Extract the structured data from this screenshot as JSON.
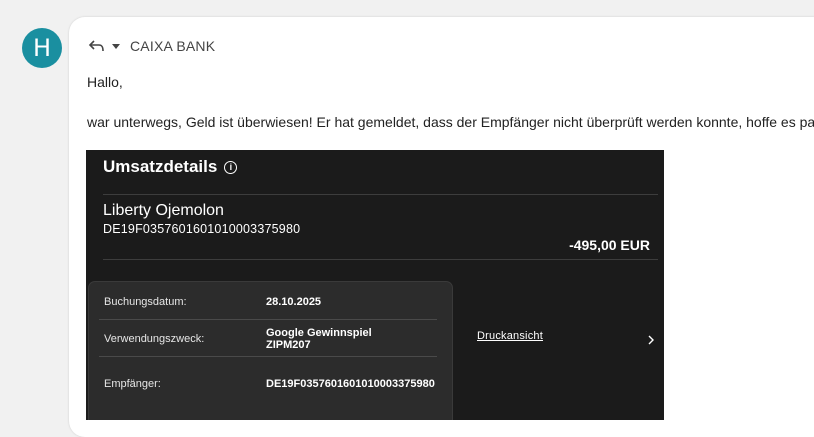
{
  "avatar": {
    "initial": "H",
    "color": "#1a8fa0"
  },
  "header": {
    "sender": "CAIXA BANK",
    "reply_icon": "reply-icon",
    "caret_icon": "chevron-down-icon"
  },
  "email": {
    "greeting": "Hallo,",
    "body": "war unterwegs, Geld ist überwiesen! Er hat gemeldet, dass der Empfänger nicht überprüft werden konnte, hoffe es passt."
  },
  "bank": {
    "title": "Umsatzdetails",
    "info_icon": "info-icon",
    "payee": "Liberty Ojemolon",
    "iban": "DE19F0357601601010003375980",
    "amount": "-495,00 EUR",
    "rows": [
      {
        "label": "Buchungsdatum:",
        "value": "28.10.2025"
      },
      {
        "label": "Verwendungszweck:",
        "value_line1": "Google Gewinnspiel",
        "value_line2": "ZIPM207"
      },
      {
        "label": "Empfänger:",
        "value": "DE19F0357601601010003375980"
      }
    ],
    "print_link": "Druckansicht",
    "background": "#1b1b1b"
  }
}
